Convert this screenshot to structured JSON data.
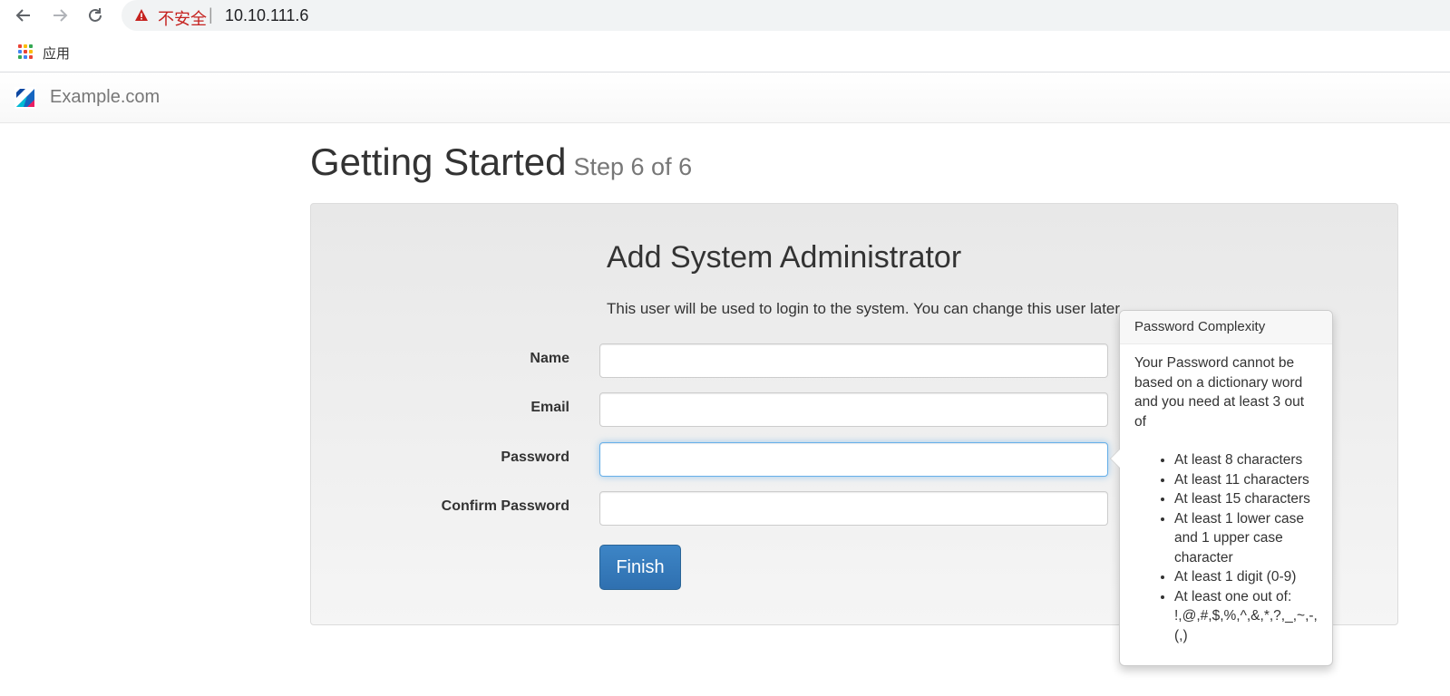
{
  "browser": {
    "insecure_label": "不安全",
    "separator": "|",
    "url": "10.10.111.6",
    "bookmarks_apps_label": "应用"
  },
  "navbar": {
    "brand": "Example.com"
  },
  "page": {
    "title": "Getting Started",
    "step": "Step 6 of 6"
  },
  "form": {
    "heading": "Add System Administrator",
    "description": "This user will be used to login to the system. You can change this user later.",
    "fields": [
      {
        "label": "Name",
        "value": ""
      },
      {
        "label": "Email",
        "value": ""
      },
      {
        "label": "Password",
        "value": ""
      },
      {
        "label": "Confirm Password",
        "value": ""
      }
    ],
    "submit_label": "Finish"
  },
  "popover": {
    "title": "Password Complexity",
    "intro": "Your Password cannot be based on a dictionary word and you need at least 3 out of",
    "rules": [
      "At least 8 characters",
      "At least 11 characters",
      "At least 15 characters",
      "At least 1 lower case and 1 upper case character",
      "At least 1 digit (0-9)",
      "At least one out of: !,@,#,$,%,^,&,*,?,_,~,-,(,)"
    ]
  },
  "colors": {
    "primary_button": "#337ab7",
    "insecure_warning": "#c5221f",
    "focus_border": "#66afe9"
  }
}
